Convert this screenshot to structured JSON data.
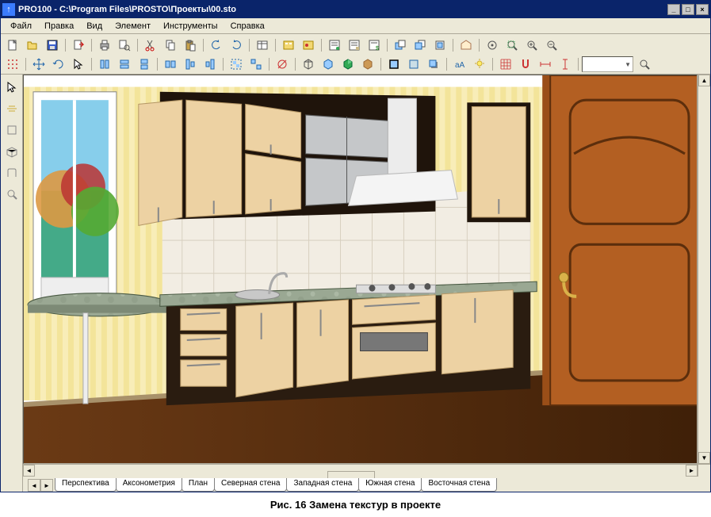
{
  "app": {
    "title": "PRO100 - C:\\Program Files\\PROSTO\\Проекты\\00.sto"
  },
  "menu": {
    "file": "Файл",
    "edit": "Правка",
    "view": "Вид",
    "element": "Элемент",
    "tools": "Инструменты",
    "help": "Справка"
  },
  "tabs": {
    "perspective": "Перспектива",
    "axon": "Аксонометрия",
    "plan": "План",
    "north": "Северная стена",
    "west": "Западная стена",
    "south": "Южная стена",
    "east": "Восточная стена"
  },
  "combo": {
    "value": ""
  },
  "caption": "Рис. 16  Замена текстур  в проекте"
}
